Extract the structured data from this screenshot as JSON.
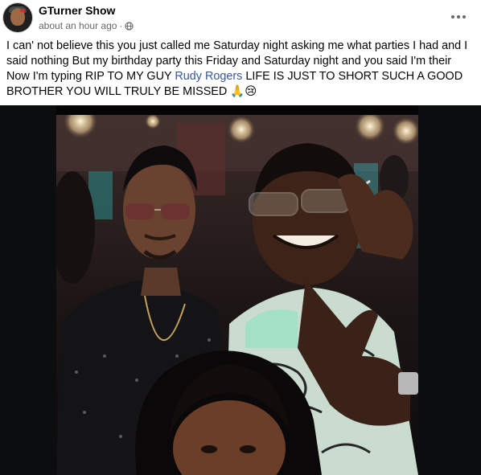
{
  "post": {
    "author": "GTurner Show",
    "timestamp": "about an hour ago",
    "dot": "·",
    "privacy_icon": "globe-icon",
    "more_icon": "more-options-icon",
    "message": {
      "text_before": "I can' not believe this you just called me Saturday night asking me what parties I had and I said nothing But my birthday party  this Friday and Saturday night and you said I'm their Now I'm typing RIP TO MY GUY ",
      "mention": "Rudy Rogers",
      "text_after": "  LIFE IS JUST TO SHORT SUCH A GOOD BROTHER YOU WILL TRULY BE MISSED ",
      "emojis": "🙏😢"
    },
    "photo_icon": "group-selfie-photo"
  },
  "colors": {
    "link": "#385898",
    "secondary_text": "#65676b",
    "photo_background": "#050505"
  }
}
